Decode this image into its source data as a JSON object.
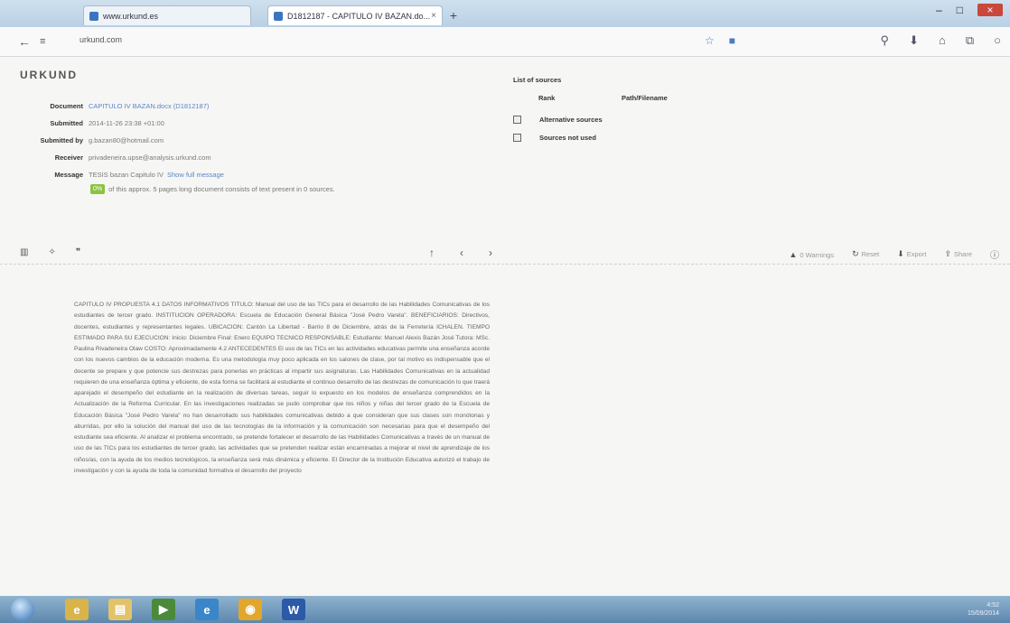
{
  "browser": {
    "tabs": [
      {
        "label": "www.urkund.es"
      },
      {
        "label": "D1812187 - CAPITULO IV BAZAN.do..."
      }
    ],
    "url": "urkund.com"
  },
  "logo": "URKUND",
  "meta": {
    "document_label": "Document",
    "document_value": "CAPITULO IV BAZAN.docx (D1812187)",
    "submitted_label": "Submitted",
    "submitted_value": "2014-11-26 23:38 +01:00",
    "submitted_by_label": "Submitted by",
    "submitted_by_value": "g.bazan80@hotmail.com",
    "receiver_label": "Receiver",
    "receiver_value": "privadeneira.upse@analysis.urkund.com",
    "message_label": "Message",
    "message_value": "TESIS bazan Capitulo IV",
    "show_full": "Show full message",
    "percent": "0%",
    "percent_text": "of this approx. 5 pages long document consists of text present in 0 sources."
  },
  "sources": {
    "title": "List of sources",
    "col_rank": "Rank",
    "col_path": "Path/Filename",
    "alternative": "Alternative sources",
    "not_used": "Sources not used"
  },
  "toolbar": {
    "left_icons": [
      "chart-icon",
      "settings-icon",
      "quote-icon"
    ],
    "warnings": "0 Warnings",
    "reset": "Reset",
    "export": "Export",
    "share": "Share"
  },
  "document_text": "CAPITULO IV PROPUESTA 4.1 DATOS INFORMATIVOS TITULO: Manual del uso de las TICs para el desarrollo de las Habilidades Comunicativas de los estudiantes de tercer grado. INSTITUCION OPERADORA: Escuela de Educación General Básica \"José Pedro Varela\". BENEFICIARIOS: Directivos, docentes, estudiantes y representantes legales. UBICACION: Cantón La Libertad - Barrio 8 de Diciembre, atrás de la Ferretería ICHALEN. TIEMPO ESTIMADO PARA SU EJECUCION: Inicio: Diciembre Final: Enero EQUIPO TECNICO RESPONSABLE: Estudiante: Manuel Alexis Bazán José Tutora: MSc. Paulina Rivadeneira Olaw COSTO: Aproximadamente 4.2 ANTECEDENTES El uso de las TICs en las actividades educativas permite una enseñanza acorde con los nuevos cambios de la educación moderna. Es una metodología muy poco aplicada en los salones de clase, por tal motivo es indispensable que el docente se prepare y que potencie sus destrezas para ponerlas en prácticas al impartir sus asignaturas. Las Habilidades Comunicativas en la actualidad requieren de una enseñanza óptima y eficiente, de esta forma se facilitará al estudiante el continuo desarrollo de las destrezas de comunicación lo que traerá aparejado el desempeño del estudiante en la realización de diversas tareas, seguir lo expuesto en los modelos de enseñanza comprendidos en la Actualización de la Reforma Curricular. En las investigaciones realizadas se pudo comprobar que los niños y niñas del tercer grado de la Escuela de Educación Básica \"José Pedro Varela\" no han desarrollado sus habilidades comunicativas debido a que consideran que sus clases son monótonas y aburridas, por ello la solución del manual del uso de las tecnologías de la información y la comunicación son necesarias para que el desempeño del estudiante sea eficiente. Al analizar el problema encontrado, se pretende fortalecer el desarrollo de las Habilidades Comunicativas a través de un manual de uso de las TICs para los estudiantes de tercer grado, las actividades que se pretenden realizar están encaminadas a mejorar el nivel de aprendizaje de los niños/as, con la ayuda de los medios tecnológicos, la enseñanza será más dinámica y eficiente. El Director de la Institución Educativa autorizó el trabajo de investigación y con la ayuda de toda la comunidad formativa el desarrollo del proyecto",
  "taskbar": {
    "time": "4:52",
    "date": "15/09/2014",
    "apps": [
      "ie-icon",
      "folder-icon",
      "media-icon",
      "ie-icon",
      "chrome-icon",
      "word-icon"
    ]
  }
}
